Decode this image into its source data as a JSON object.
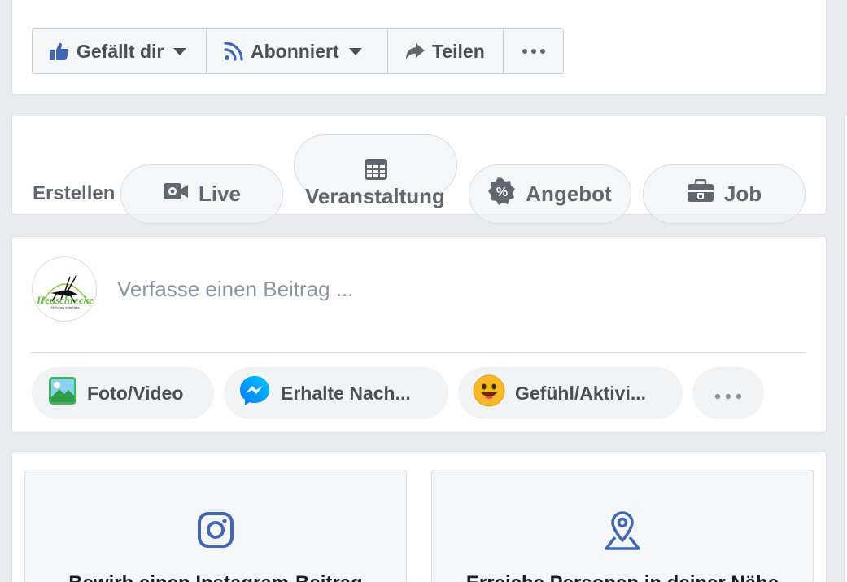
{
  "page_actions": {
    "like_label": "Gefällt dir",
    "subscribe_label": "Abonniert",
    "share_label": "Teilen"
  },
  "create": {
    "label": "Erstellen",
    "live_label": "Live",
    "event_label": "Veranstaltung",
    "offer_label": "Angebot",
    "job_label": "Job"
  },
  "composer": {
    "avatar_text": "Heuschrecke",
    "avatar_tagline": "Ein Sprung in die Natur",
    "placeholder": "Verfasse einen Beitrag ...",
    "photo_label": "Foto/Video",
    "messenger_label": "Erhalte Nach...",
    "feeling_label": "Gefühl/Aktivi..."
  },
  "promos": {
    "instagram_label": "Bewirb einen Instagram-Beitrag",
    "local_label": "Erreiche Personen in deiner Nähe"
  },
  "colors": {
    "facebook_blue": "#4267b2",
    "text_gray": "#606770",
    "background": "#e9ebee"
  }
}
